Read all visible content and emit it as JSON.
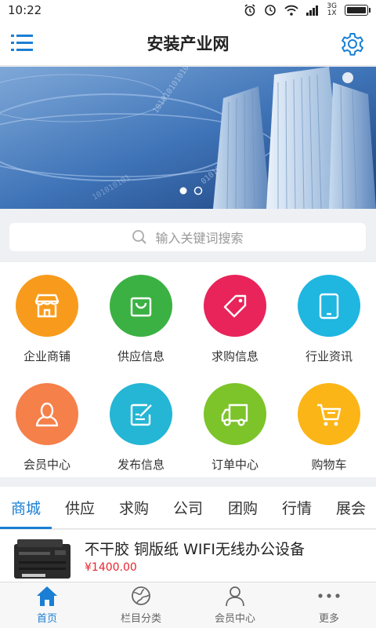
{
  "status_bar": {
    "time": "10:22",
    "network_top": "3G",
    "network_bottom": "1X"
  },
  "header": {
    "title": "安装产业网",
    "menu_icon": "hamburger-menu-icon",
    "settings_icon": "gear-icon"
  },
  "banner": {
    "slides": 2,
    "active_slide": 1
  },
  "search": {
    "placeholder": "输入关键词搜索",
    "icon": "search-icon"
  },
  "grid": {
    "items": [
      {
        "label": "企业商铺",
        "icon": "store-icon",
        "color": "#f89b1c"
      },
      {
        "label": "供应信息",
        "icon": "shopping-bag-icon",
        "color": "#3bb143"
      },
      {
        "label": "求购信息",
        "icon": "price-tag-icon",
        "color": "#e8245a"
      },
      {
        "label": "行业资讯",
        "icon": "tablet-icon",
        "color": "#1fb6e0"
      },
      {
        "label": "会员中心",
        "icon": "user-icon",
        "color": "#f5804a"
      },
      {
        "label": "发布信息",
        "icon": "edit-icon",
        "color": "#24b6d4"
      },
      {
        "label": "订单中心",
        "icon": "truck-icon",
        "color": "#7cc42a"
      },
      {
        "label": "购物车",
        "icon": "cart-icon",
        "color": "#fbb516"
      }
    ]
  },
  "tabs": {
    "active": "商城",
    "items": [
      "商城",
      "供应",
      "求购",
      "公司",
      "团购",
      "行情",
      "展会"
    ]
  },
  "product": {
    "name": "不干胶 铜版纸 WIFI无线办公设备",
    "price": "¥1400.00"
  },
  "bottom_nav": {
    "items": [
      {
        "label": "首页",
        "icon": "home-icon",
        "active": true
      },
      {
        "label": "栏目分类",
        "icon": "globe-icon",
        "active": false
      },
      {
        "label": "会员中心",
        "icon": "user-icon",
        "active": false
      },
      {
        "label": "更多",
        "icon": "more-dots-icon",
        "active": false
      }
    ]
  },
  "colors": {
    "accent": "#1a7fd4",
    "price": "#e8242a"
  }
}
